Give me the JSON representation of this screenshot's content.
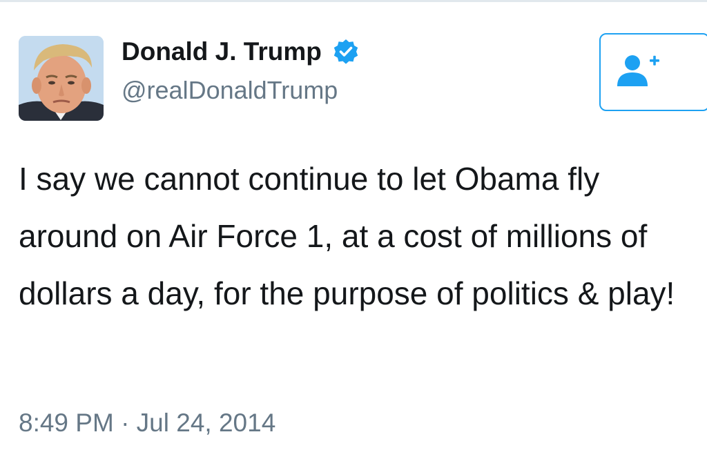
{
  "tweet": {
    "display_name": "Donald J. Trump",
    "handle": "@realDonaldTrump",
    "text": "I say we cannot continue to let Obama fly around on Air Force 1, at a cost of millions of dollars a day, for the purpose of politics & play!",
    "timestamp": "8:49 PM · Jul 24, 2014"
  },
  "icons": {
    "verified": "verified-badge-icon",
    "follow": "follow-user-plus-icon"
  },
  "colors": {
    "accent": "#1da1f2",
    "name_text": "#14171a",
    "secondary_text": "#657786"
  }
}
